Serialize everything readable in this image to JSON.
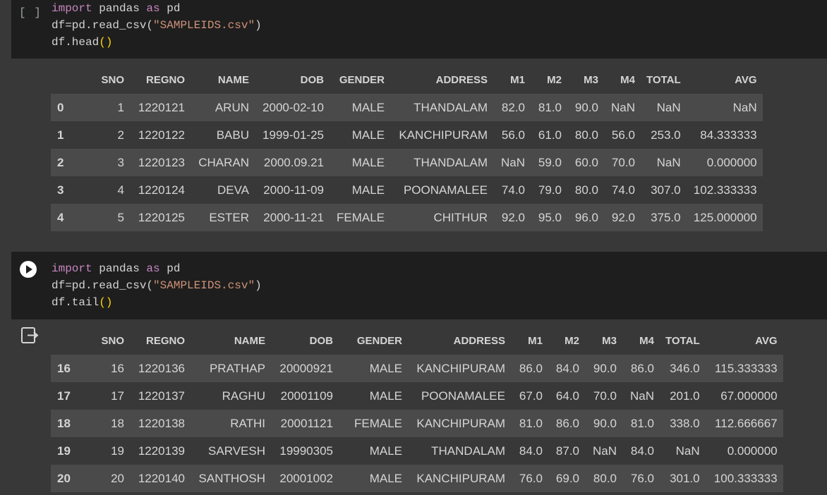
{
  "cell1": {
    "run_indicator": "[ ]",
    "code": {
      "line1": {
        "kw1": "import",
        "mid": " pandas ",
        "kw2": "as",
        "end": " pd"
      },
      "line2": {
        "pre": "df=pd.read_csv(",
        "str": "\"SAMPLEIDS.csv\"",
        "post": ")"
      },
      "line3": {
        "pre": "df.head",
        "paren": "()"
      }
    },
    "table": {
      "columns": [
        "",
        "SNO",
        "REGNO",
        "NAME",
        "DOB",
        "GENDER",
        "ADDRESS",
        "M1",
        "M2",
        "M3",
        "M4",
        "TOTAL",
        "AVG"
      ],
      "rows": [
        [
          "0",
          "1",
          "1220121",
          "ARUN",
          "2000-02-10",
          "MALE",
          "THANDALAM",
          "82.0",
          "81.0",
          "90.0",
          "NaN",
          "NaN",
          "NaN"
        ],
        [
          "1",
          "2",
          "1220122",
          "BABU",
          "1999-01-25",
          "MALE",
          "KANCHIPURAM",
          "56.0",
          "61.0",
          "80.0",
          "56.0",
          "253.0",
          "84.333333"
        ],
        [
          "2",
          "3",
          "1220123",
          "CHARAN",
          "2000.09.21",
          "MALE",
          "THANDALAM",
          "NaN",
          "59.0",
          "60.0",
          "70.0",
          "NaN",
          "0.000000"
        ],
        [
          "3",
          "4",
          "1220124",
          "DEVA",
          "2000-11-09",
          "MALE",
          "POONAMALEE",
          "74.0",
          "79.0",
          "80.0",
          "74.0",
          "307.0",
          "102.333333"
        ],
        [
          "4",
          "5",
          "1220125",
          "ESTER",
          "2000-11-21",
          "FEMALE",
          "CHITHUR",
          "92.0",
          "95.0",
          "96.0",
          "92.0",
          "375.0",
          "125.000000"
        ]
      ]
    }
  },
  "cell2": {
    "code": {
      "line1": {
        "kw1": "import",
        "mid": " pandas ",
        "kw2": "as",
        "end": " pd"
      },
      "line2": {
        "pre": "df=pd.read_csv(",
        "str": "\"SAMPLEIDS.csv\"",
        "post": ")"
      },
      "line3": {
        "pre": "df.tail",
        "paren": "()"
      }
    },
    "table": {
      "columns": [
        "",
        "SNO",
        "REGNO",
        "NAME",
        "DOB",
        "GENDER",
        "ADDRESS",
        "M1",
        "M2",
        "M3",
        "M4",
        "TOTAL",
        "AVG"
      ],
      "rows": [
        [
          "16",
          "16",
          "1220136",
          "PRATHAP",
          "20000921",
          "MALE",
          "KANCHIPURAM",
          "86.0",
          "84.0",
          "90.0",
          "86.0",
          "346.0",
          "115.333333"
        ],
        [
          "17",
          "17",
          "1220137",
          "RAGHU",
          "20001109",
          "MALE",
          "POONAMALEE",
          "67.0",
          "64.0",
          "70.0",
          "NaN",
          "201.0",
          "67.000000"
        ],
        [
          "18",
          "18",
          "1220138",
          "RATHI",
          "20001121",
          "FEMALE",
          "KANCHIPURAM",
          "81.0",
          "86.0",
          "90.0",
          "81.0",
          "338.0",
          "112.666667"
        ],
        [
          "19",
          "19",
          "1220139",
          "SARVESH",
          "19990305",
          "MALE",
          "THANDALAM",
          "84.0",
          "87.0",
          "NaN",
          "84.0",
          "NaN",
          "0.000000"
        ],
        [
          "20",
          "20",
          "1220140",
          "SANTHOSH",
          "20001002",
          "MALE",
          "KANCHIPURAM",
          "76.0",
          "69.0",
          "80.0",
          "76.0",
          "301.0",
          "100.333333"
        ]
      ]
    }
  }
}
